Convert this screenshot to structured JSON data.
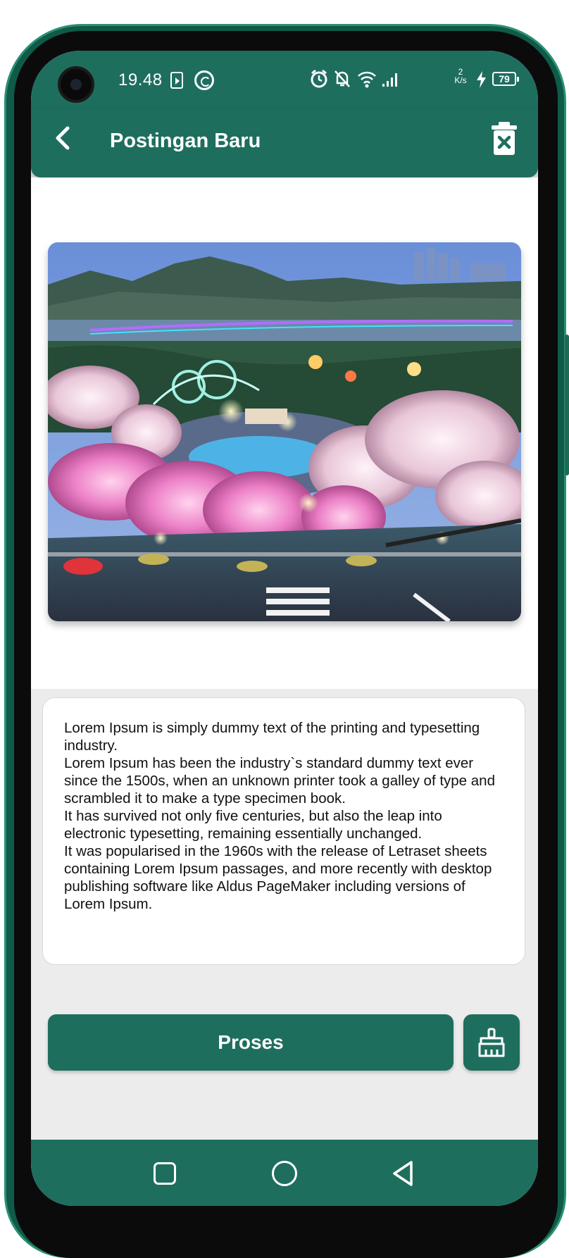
{
  "statusbar": {
    "time": "19.48",
    "network_speed_value": "2",
    "network_speed_unit": "K/s",
    "battery": "79"
  },
  "appbar": {
    "title": "Postingan Baru"
  },
  "content": {
    "text": "Lorem Ipsum is simply dummy text of the printing and typesetting industry.\nLorem Ipsum has been the industry`s standard dummy text ever since the 1500s, when an unknown printer took a galley of type and scrambled it to make a type specimen book.\nIt has survived not only five centuries, but also the leap into electronic typesetting, remaining essentially unchanged.\nIt was popularised in the 1960s with the release of Letraset sheets containing Lorem Ipsum passages, and more recently with desktop publishing software like Aldus PageMaker including versions of Lorem Ipsum."
  },
  "actions": {
    "process_label": "Proses"
  },
  "icons": {
    "back": "back-arrow-icon",
    "delete": "trash-icon",
    "clear": "broom-icon",
    "nav_recent": "square-icon",
    "nav_home": "circle-icon",
    "nav_back": "triangle-back-icon"
  },
  "colors": {
    "primary": "#1e6e5e",
    "background": "#ececec",
    "card": "#ffffff",
    "frame": "#0f5a48"
  }
}
